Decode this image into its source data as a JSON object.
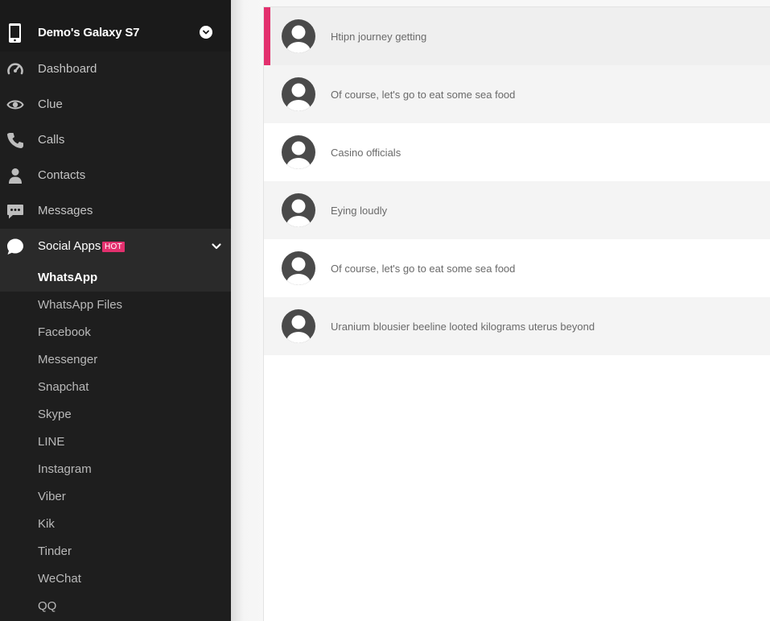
{
  "sidebar": {
    "device_name": "Demo's Galaxy S7",
    "nav": [
      {
        "label": "Dashboard",
        "icon": "dashboard-icon"
      },
      {
        "label": "Clue",
        "icon": "eye-icon"
      },
      {
        "label": "Calls",
        "icon": "phone-icon"
      },
      {
        "label": "Contacts",
        "icon": "person-icon"
      },
      {
        "label": "Messages",
        "icon": "message-icon"
      }
    ],
    "social": {
      "label": "Social Apps",
      "badge": "HOT",
      "icon": "chat-bubble-icon"
    },
    "sub_items": [
      {
        "label": "WhatsApp",
        "active": true
      },
      {
        "label": "WhatsApp Files"
      },
      {
        "label": "Facebook"
      },
      {
        "label": "Messenger"
      },
      {
        "label": "Snapchat"
      },
      {
        "label": "Skype"
      },
      {
        "label": "LINE"
      },
      {
        "label": "Instagram"
      },
      {
        "label": "Viber"
      },
      {
        "label": "Kik"
      },
      {
        "label": "Tinder"
      },
      {
        "label": "WeChat"
      },
      {
        "label": "QQ"
      }
    ]
  },
  "conversations": [
    {
      "text": "Htipn journey getting",
      "selected": true
    },
    {
      "text": "Of course, let's go to eat some sea food"
    },
    {
      "text": "Casino officials"
    },
    {
      "text": "Eying loudly"
    },
    {
      "text": "Of course, let's go to eat some sea food"
    },
    {
      "text": "Uranium blousier beeline looted kilograms uterus beyond"
    }
  ],
  "colors": {
    "accent": "#e3306e",
    "sidebar_bg": "#1e1e1e"
  }
}
